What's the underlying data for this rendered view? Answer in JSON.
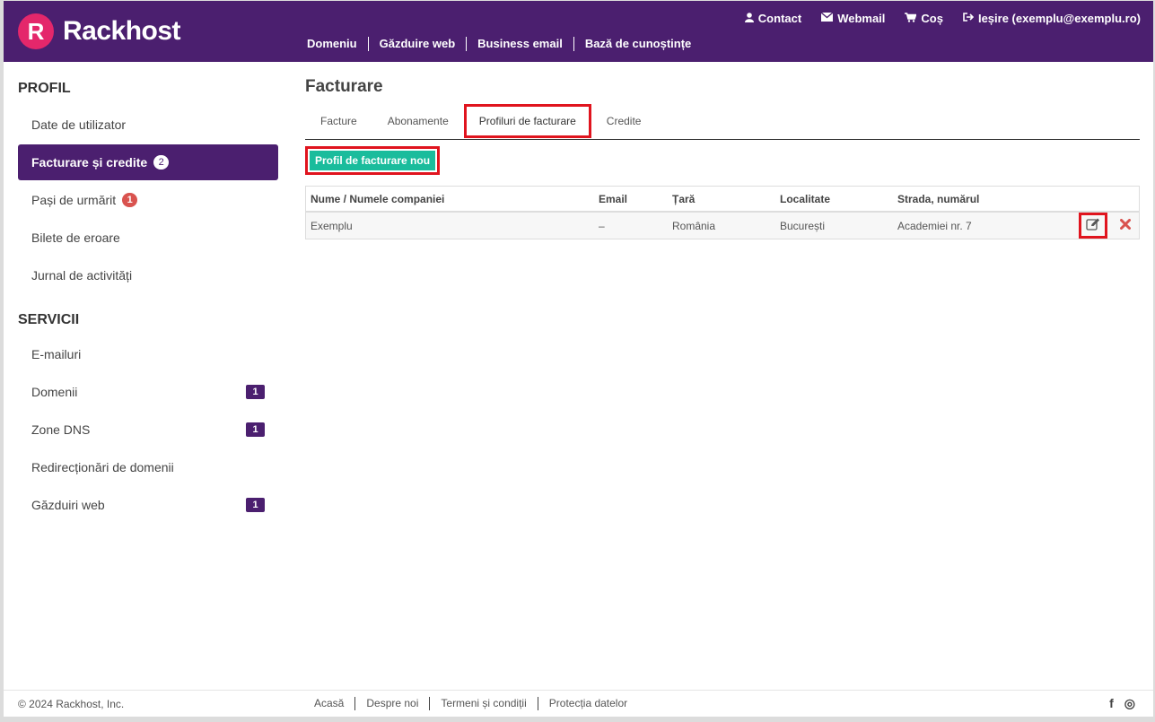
{
  "brand": {
    "logo_letter": "R",
    "name": "Rackhost"
  },
  "top_nav": [
    {
      "icon": "user-icon",
      "label": "Contact"
    },
    {
      "icon": "envelope-icon",
      "label": "Webmail"
    },
    {
      "icon": "cart-icon",
      "label": "Coș"
    },
    {
      "icon": "sign-out-icon",
      "label": "Ieșire (exemplu@exemplu.ro)"
    }
  ],
  "main_nav": [
    "Domeniu",
    "Găzduire web",
    "Business email",
    "Bază de cunoștințe"
  ],
  "sidebar": {
    "profil_heading": "PROFIL",
    "profil_items": [
      {
        "label": "Date de utilizator"
      },
      {
        "label": "Facturare și credite",
        "badge": "2",
        "active": true
      },
      {
        "label": "Pași de urmărit",
        "badge": "1"
      },
      {
        "label": "Bilete de eroare"
      },
      {
        "label": "Jurnal de activități"
      }
    ],
    "servicii_heading": "SERVICII",
    "servicii_items": [
      {
        "label": "E-mailuri"
      },
      {
        "label": "Domenii",
        "badge": "1"
      },
      {
        "label": "Zone DNS",
        "badge": "1"
      },
      {
        "label": "Redirecționări de domenii"
      },
      {
        "label": "Găzduiri web",
        "badge": "1"
      }
    ]
  },
  "main": {
    "title": "Facturare",
    "tabs": [
      "Facture",
      "Abonamente",
      "Profiluri de facturare",
      "Credite"
    ],
    "active_tab": "Profiluri de facturare",
    "new_button": "Profil de facturare nou",
    "table": {
      "headers": [
        "Nume / Numele companiei",
        "Email",
        "Țară",
        "Localitate",
        "Strada, numărul"
      ],
      "rows": [
        [
          "Exemplu",
          "–",
          "România",
          "București",
          "Academiei nr. 7"
        ]
      ]
    }
  },
  "footer": {
    "copyright": "© 2024 Rackhost, Inc.",
    "links": [
      "Acasă",
      "Despre noi",
      "Termeni și condiții",
      "Protecția datelor"
    ],
    "social": [
      {
        "icon": "facebook-icon",
        "glyph": "f"
      },
      {
        "icon": "instagram-icon",
        "glyph": "◎"
      }
    ]
  },
  "colors": {
    "brand_purple": "#4b1f6f",
    "accent_pink": "#e4276b",
    "button_green": "#1abc9c",
    "highlight_red": "#e0141e",
    "delete_red": "#d9534f"
  }
}
